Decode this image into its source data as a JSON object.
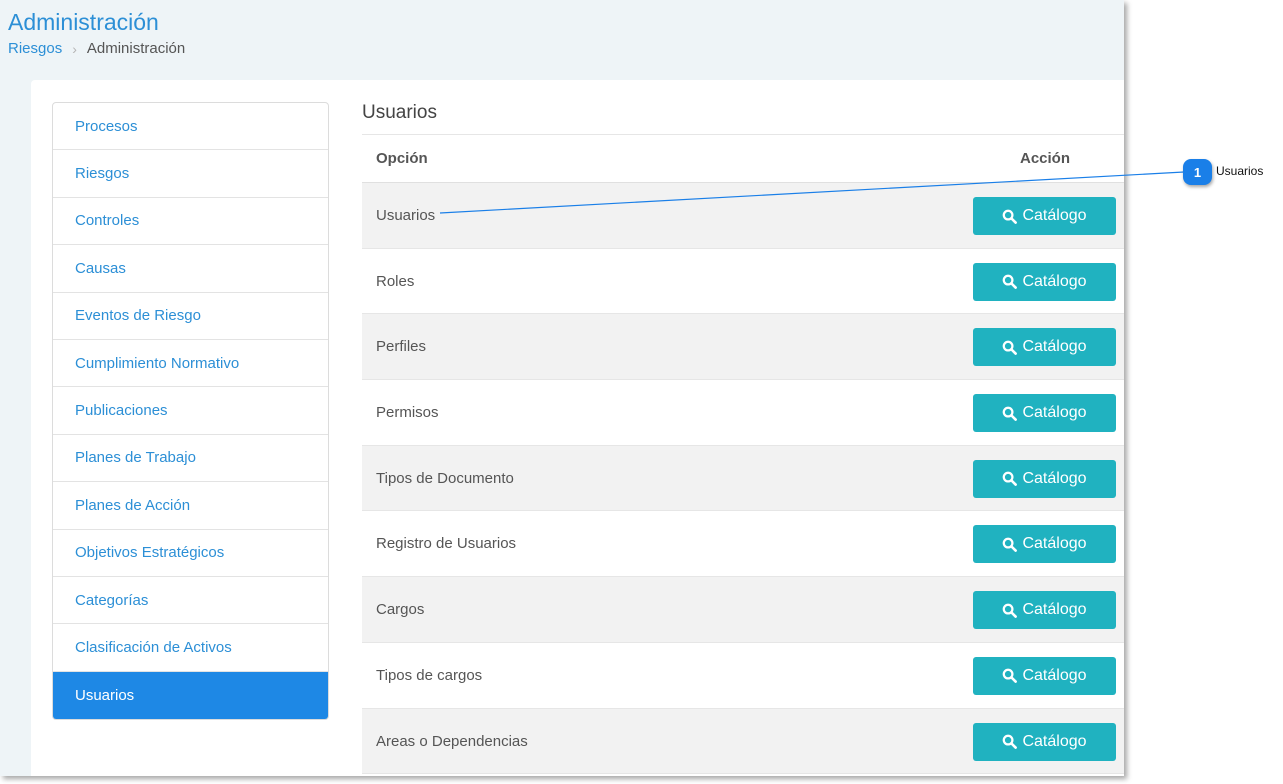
{
  "header": {
    "title": "Administración",
    "breadcrumb": {
      "link": "Riesgos",
      "current": "Administración"
    }
  },
  "sidebar": {
    "items": [
      {
        "label": "Procesos"
      },
      {
        "label": "Riesgos"
      },
      {
        "label": "Controles"
      },
      {
        "label": "Causas"
      },
      {
        "label": "Eventos de Riesgo"
      },
      {
        "label": "Cumplimiento Normativo"
      },
      {
        "label": "Publicaciones"
      },
      {
        "label": "Planes de Trabajo"
      },
      {
        "label": "Planes de Acción"
      },
      {
        "label": "Objetivos Estratégicos"
      },
      {
        "label": "Categorías"
      },
      {
        "label": "Clasificación de Activos"
      },
      {
        "label": "Usuarios"
      }
    ],
    "active_index": 12
  },
  "main": {
    "section_title": "Usuarios",
    "table": {
      "headers": {
        "option": "Opción",
        "action": "Acción"
      },
      "rows": [
        {
          "label": "Usuarios",
          "button": "Catálogo"
        },
        {
          "label": "Roles",
          "button": "Catálogo"
        },
        {
          "label": "Perfiles",
          "button": "Catálogo"
        },
        {
          "label": "Permisos",
          "button": "Catálogo"
        },
        {
          "label": "Tipos de Documento",
          "button": "Catálogo"
        },
        {
          "label": "Registro de Usuarios",
          "button": "Catálogo"
        },
        {
          "label": "Cargos",
          "button": "Catálogo"
        },
        {
          "label": "Tipos de cargos",
          "button": "Catálogo"
        },
        {
          "label": "Areas o Dependencias",
          "button": "Catálogo"
        }
      ]
    }
  },
  "callout": {
    "number": "1",
    "label": "Usuarios"
  },
  "colors": {
    "accent": "#2c8fd6",
    "active": "#1e88e5",
    "button": "#20b2c0",
    "callout": "#1a7fe8"
  },
  "icons": {
    "button_icon": "search-icon"
  }
}
